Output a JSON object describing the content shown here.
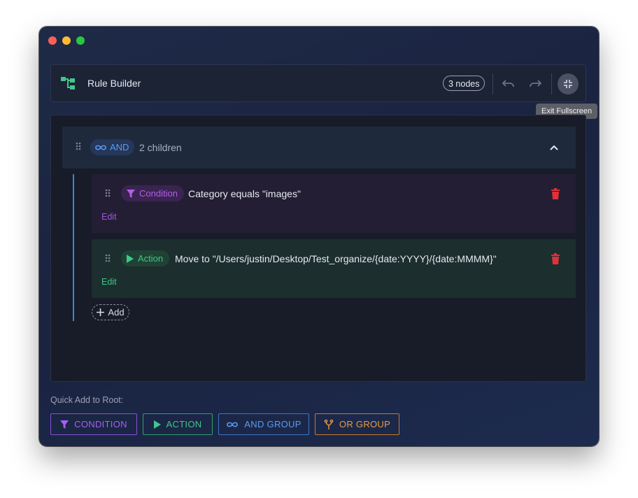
{
  "window": {
    "traffic_lights": [
      "close",
      "minimize",
      "zoom"
    ]
  },
  "header": {
    "logo_icon": "tree-structure-icon",
    "title": "Rule Builder",
    "node_count": "3 nodes",
    "undo_icon": "undo-icon",
    "redo_icon": "redo-icon",
    "fullscreen_icon": "exit-fullscreen-icon",
    "tooltip": "Exit Fullscreen"
  },
  "tree": {
    "group": {
      "operator": "AND",
      "children_text": "2 children",
      "collapse_icon": "chevron-up-icon"
    },
    "children": [
      {
        "type_label": "Condition",
        "text": "Category equals \"images\"",
        "edit_label": "Edit",
        "icon": "filter-icon"
      },
      {
        "type_label": "Action",
        "text": "Move to \"/Users/justin/Desktop/Test_organize/{date:YYYY}/{date:MMMM}\"",
        "edit_label": "Edit",
        "icon": "play-icon"
      }
    ],
    "add_label": "Add"
  },
  "quick_add": {
    "label": "Quick Add to Root:",
    "buttons": [
      {
        "label": "CONDITION",
        "icon": "filter-icon"
      },
      {
        "label": "ACTION",
        "icon": "play-icon"
      },
      {
        "label": "AND GROUP",
        "icon": "infinity-icon"
      },
      {
        "label": "OR GROUP",
        "icon": "fork-icon"
      }
    ]
  },
  "colors": {
    "condition": "#a45ff0",
    "action": "#3fc88a",
    "and_group": "#5b9bf0",
    "or_group": "#eb9a44",
    "delete": "#e0303a"
  }
}
